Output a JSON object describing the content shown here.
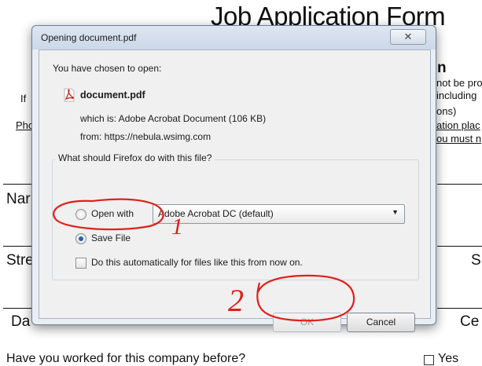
{
  "document": {
    "title": "Job Application Form",
    "right_fragments": {
      "line1": "n",
      "line2": "not be pro",
      "line3": "including",
      "line4": "ons)",
      "line5": "ation plac",
      "line6": "ou must n"
    },
    "left_fragments": {
      "if": "If",
      "pho": "Pho",
      "nar": "Nar",
      "stre": "Stre",
      "da": "Da"
    },
    "right_labels": {
      "s": "S",
      "ce": "Ce"
    },
    "bottom_question": "Have you worked for this company before?",
    "bottom_yes": "Yes"
  },
  "dialog": {
    "title": "Opening document.pdf",
    "close_symbol": "✕",
    "intro": "You have chosen to open:",
    "file_icon": "pdf-file-icon",
    "filename": "document.pdf",
    "which_is": "which is:  Adobe Acrobat Document (106 KB)",
    "from": "from:  https://nebula.wsimg.com",
    "question": "What should Firefox do with this file?",
    "open_with_label": "Open with",
    "open_with_app": "Adobe Acrobat DC  (default)",
    "save_file_label": "Save File",
    "save_file_selected": true,
    "auto_label": "Do this automatically for files like this from now on.",
    "auto_checked": false,
    "ok_label": "OK",
    "ok_enabled": false,
    "cancel_label": "Cancel"
  },
  "annotations": {
    "mark_1": "1",
    "mark_2": "2",
    "color": "#e0201b"
  }
}
